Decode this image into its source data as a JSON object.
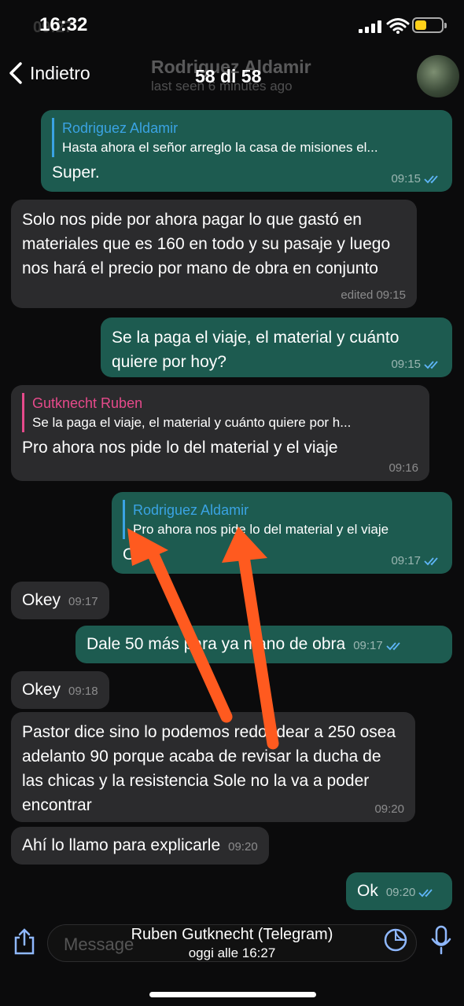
{
  "status": {
    "time": "16:32",
    "ghost_time": "09:27"
  },
  "header": {
    "back_label": "Indietro",
    "contact_name": "Rodriguez Aldamir",
    "last_seen": "last seen 6 minutes ago",
    "counter": "58 di 58"
  },
  "messages": [
    {
      "dir": "out",
      "reply_name": "Rodriguez Aldamir",
      "reply_text": "Hasta ahora el señor arreglo la casa de misiones el...",
      "text": "Super.",
      "time": "09:15",
      "read": true
    },
    {
      "dir": "in",
      "text": "Solo nos pide por ahora pagar lo que gastó en materiales que es 160 en todo y su pasaje y luego nos hará el precio por mano de obra en conjunto",
      "time": "edited 09:15"
    },
    {
      "dir": "out",
      "text": "Se la paga el viaje, el material y cuánto quiere por hoy?",
      "time": "09:15",
      "read": true
    },
    {
      "dir": "in",
      "reply_name": "Gutknecht Ruben",
      "reply_text": "Se la paga el viaje, el material y cuánto quiere por h...",
      "text": "Pro ahora nos pide lo del material y el viaje",
      "time": "09:16"
    },
    {
      "dir": "out",
      "reply_name": "Rodriguez Aldamir",
      "reply_text": "Pro ahora nos pide lo del material y el viaje",
      "text": "Ok",
      "time": "09:17",
      "read": true
    },
    {
      "dir": "in",
      "text": "Okey",
      "time": "09:17"
    },
    {
      "dir": "out",
      "text": "Dale 50 más para ya mano de obra",
      "time": "09:17",
      "read": true
    },
    {
      "dir": "in",
      "text": "Okey",
      "time": "09:18"
    },
    {
      "dir": "in",
      "text": "Pastor dice sino lo podemos redondear a 250 osea adelanto 90 porque acaba de revisar la ducha de las chicas y la resistencia Sole no la va a poder encontrar",
      "time": "09:20"
    },
    {
      "dir": "in",
      "text": "Ahí lo llamo para explicarle",
      "time": "09:20"
    },
    {
      "dir": "out",
      "text": "Ok",
      "time": "09:20",
      "read": true
    }
  ],
  "input": {
    "placeholder": "Message"
  },
  "caption": {
    "title": "Ruben Gutknecht (Telegram)",
    "subtitle": "oggi alle 16:27"
  },
  "colors": {
    "outgoing": "#1d5b50",
    "incoming": "#2b2b2d",
    "accent": "#3aa3e3",
    "reply_pink": "#e64a8b",
    "arrow": "#ff5a1f"
  },
  "icons": [
    "back-chevron-icon",
    "share-icon",
    "sticker-icon",
    "microphone-icon",
    "double-check-icon"
  ]
}
